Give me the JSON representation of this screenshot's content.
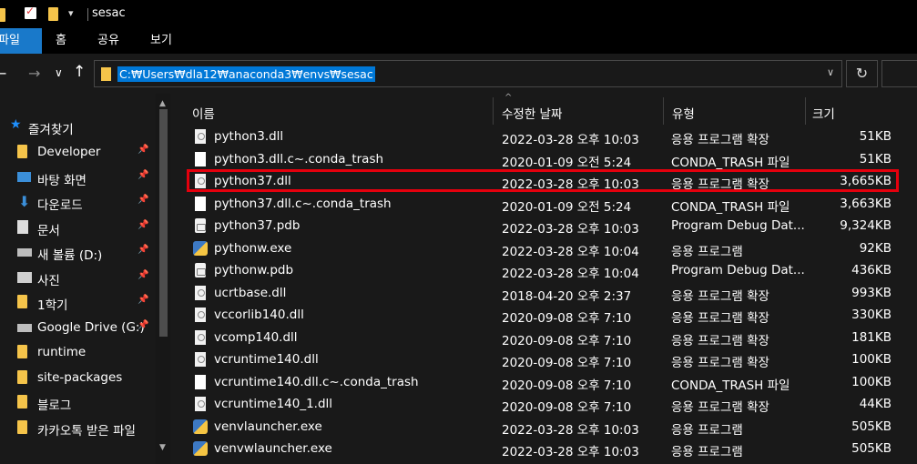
{
  "window": {
    "title": "sesac"
  },
  "ribbon": {
    "tabs": [
      "파일",
      "홈",
      "공유",
      "보기"
    ]
  },
  "address": {
    "path": "C:₩Users₩dla12₩anaconda3₩envs₩sesac"
  },
  "sidebar": {
    "quick_access": "즐겨찾기",
    "items": [
      {
        "label": "Developer",
        "icon": "folder-icon",
        "pinned": true
      },
      {
        "label": "바탕 화면",
        "icon": "desktop-icon",
        "pinned": true
      },
      {
        "label": "다운로드",
        "icon": "download-icon",
        "pinned": true
      },
      {
        "label": "문서",
        "icon": "document-icon",
        "pinned": true
      },
      {
        "label": "새 볼륨 (D:)",
        "icon": "drive-icon",
        "pinned": true
      },
      {
        "label": "사진",
        "icon": "pictures-icon",
        "pinned": true
      },
      {
        "label": "1학기",
        "icon": "folder-icon",
        "pinned": true
      },
      {
        "label": "Google Drive (G:)",
        "icon": "google-drive-icon",
        "pinned": true
      },
      {
        "label": "runtime",
        "icon": "folder-icon",
        "pinned": false
      },
      {
        "label": "site-packages",
        "icon": "folder-icon",
        "pinned": false
      },
      {
        "label": "블로그",
        "icon": "folder-icon",
        "pinned": false
      },
      {
        "label": "카카오톡 받은 파일",
        "icon": "folder-icon",
        "pinned": false
      }
    ]
  },
  "columns": {
    "name": "이름",
    "date": "수정한 날짜",
    "type": "유형",
    "size": "크기"
  },
  "files": [
    {
      "name": "python3.dll",
      "date": "2022-03-28 오후 10:03",
      "type": "응용 프로그램 확장",
      "size": "51KB",
      "icon": "dll"
    },
    {
      "name": "python3.dll.c~.conda_trash",
      "date": "2020-01-09 오전 5:24",
      "type": "CONDA_TRASH 파일",
      "size": "51KB",
      "icon": "trash"
    },
    {
      "name": "python37.dll",
      "date": "2022-03-28 오후 10:03",
      "type": "응용 프로그램 확장",
      "size": "3,665KB",
      "icon": "dll"
    },
    {
      "name": "python37.dll.c~.conda_trash",
      "date": "2020-01-09 오전 5:24",
      "type": "CONDA_TRASH 파일",
      "size": "3,663KB",
      "icon": "trash"
    },
    {
      "name": "python37.pdb",
      "date": "2022-03-28 오후 10:03",
      "type": "Program Debug Dat...",
      "size": "9,324KB",
      "icon": "pdb"
    },
    {
      "name": "pythonw.exe",
      "date": "2022-03-28 오후 10:04",
      "type": "응용 프로그램",
      "size": "92KB",
      "icon": "exe"
    },
    {
      "name": "pythonw.pdb",
      "date": "2022-03-28 오후 10:04",
      "type": "Program Debug Dat...",
      "size": "436KB",
      "icon": "pdb"
    },
    {
      "name": "ucrtbase.dll",
      "date": "2018-04-20 오후 2:37",
      "type": "응용 프로그램 확장",
      "size": "993KB",
      "icon": "dll"
    },
    {
      "name": "vccorlib140.dll",
      "date": "2020-09-08 오후 7:10",
      "type": "응용 프로그램 확장",
      "size": "330KB",
      "icon": "dll"
    },
    {
      "name": "vcomp140.dll",
      "date": "2020-09-08 오후 7:10",
      "type": "응용 프로그램 확장",
      "size": "181KB",
      "icon": "dll"
    },
    {
      "name": "vcruntime140.dll",
      "date": "2020-09-08 오후 7:10",
      "type": "응용 프로그램 확장",
      "size": "100KB",
      "icon": "dll"
    },
    {
      "name": "vcruntime140.dll.c~.conda_trash",
      "date": "2020-09-08 오후 7:10",
      "type": "CONDA_TRASH 파일",
      "size": "100KB",
      "icon": "trash"
    },
    {
      "name": "vcruntime140_1.dll",
      "date": "2020-09-08 오후 7:10",
      "type": "응용 프로그램 확장",
      "size": "44KB",
      "icon": "dll"
    },
    {
      "name": "venvlauncher.exe",
      "date": "2022-03-28 오후 10:03",
      "type": "응용 프로그램",
      "size": "505KB",
      "icon": "exe"
    },
    {
      "name": "venvwlauncher.exe",
      "date": "2022-03-28 오후 10:03",
      "type": "응용 프로그램",
      "size": "505KB",
      "icon": "exe"
    }
  ],
  "highlighted_file": "python37.dll",
  "colors": {
    "accent": "#0078d7",
    "highlight_border": "#e4000d",
    "background": "#191919"
  }
}
